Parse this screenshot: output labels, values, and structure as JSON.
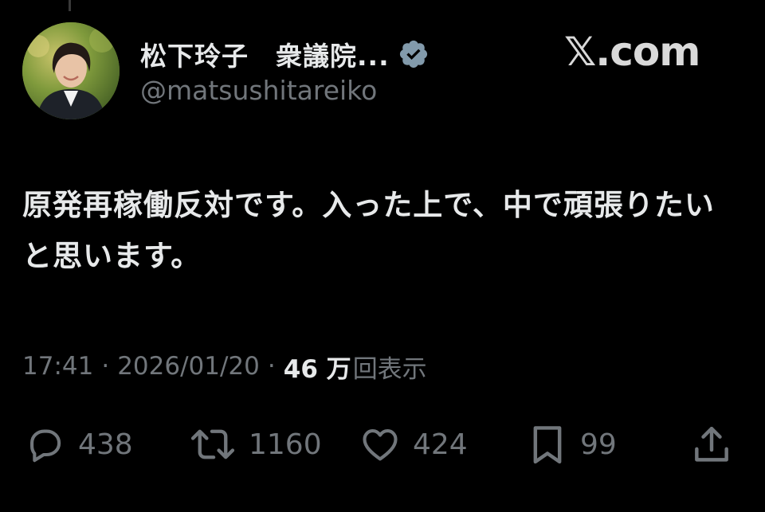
{
  "author": {
    "display_name": "松下玲子　衆議院...",
    "handle": "@matsushitareiko",
    "verified": true
  },
  "brand": {
    "x_glyph": "𝕏",
    "suffix": ".com"
  },
  "tweet": {
    "text": "原発再稼働反対です。入った上で、中で頑張りたいと思います。"
  },
  "meta": {
    "time": "17:41",
    "separator": "·",
    "date": "2026/01/20",
    "views_count": "46 万",
    "views_label": "回表示"
  },
  "actions": {
    "replies": "438",
    "reposts": "1160",
    "likes": "424",
    "bookmarks": "99"
  },
  "icons": {
    "reply": "reply-icon",
    "repost": "repost-icon",
    "like": "heart-icon",
    "bookmark": "bookmark-icon",
    "share": "share-icon",
    "verified": "verified-badge-icon"
  },
  "colors": {
    "background": "#000000",
    "primary_text": "#e7e9ea",
    "secondary_text": "#71767b",
    "verified_badge": "#829aab"
  }
}
